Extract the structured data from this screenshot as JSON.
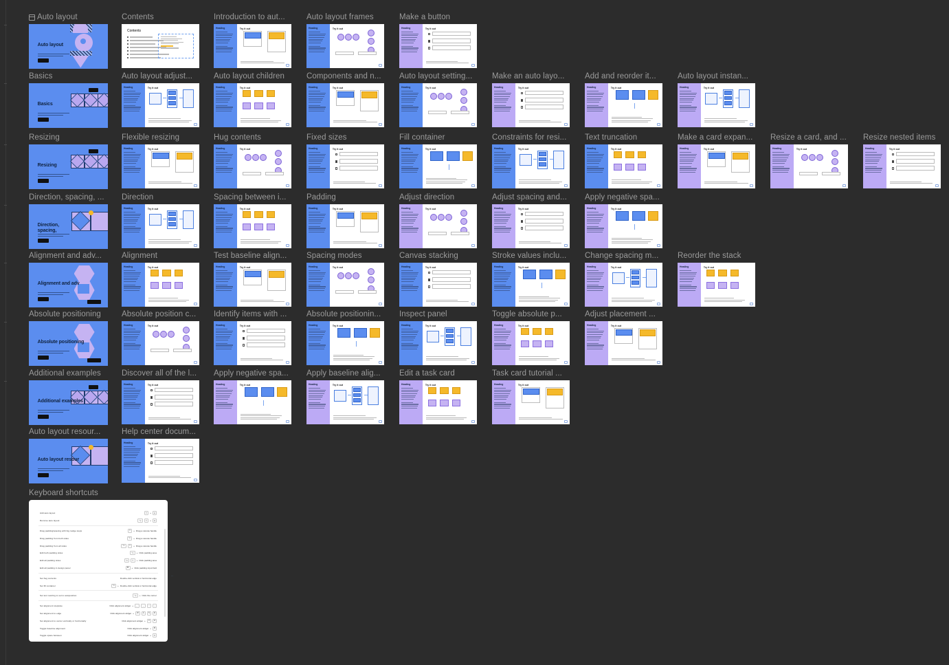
{
  "app": {
    "background_color": "#2c2c2c",
    "label_color": "#9b9b9b",
    "accent_blue": "#5b8def",
    "accent_purple": "#bcaaf5",
    "accent_yellow": "#f5b92a",
    "lavender_shape": "#c5b3f2"
  },
  "section": {
    "icon": "section-icon",
    "title": "Auto layout"
  },
  "frames": [
    {
      "title": "Auto layout",
      "style": "cover-blue",
      "row": 0,
      "col": 0,
      "wide": true
    },
    {
      "title": "Contents",
      "style": "doc-plain",
      "row": 0,
      "col": 1
    },
    {
      "title": "Introduction to aut...",
      "style": "doc-blue",
      "row": 0,
      "col": 2
    },
    {
      "title": "Auto layout frames",
      "style": "doc-blue",
      "row": 0,
      "col": 3
    },
    {
      "title": "Make a button",
      "style": "doc-purple",
      "row": 0,
      "col": 4
    },
    {
      "title": "Basics",
      "style": "cover-blue",
      "row": 1,
      "col": 0,
      "wide": true
    },
    {
      "title": "Auto layout adjust...",
      "style": "doc-blue",
      "row": 1,
      "col": 1
    },
    {
      "title": "Auto layout children",
      "style": "doc-blue",
      "row": 1,
      "col": 2
    },
    {
      "title": "Components and n...",
      "style": "doc-blue",
      "row": 1,
      "col": 3
    },
    {
      "title": "Auto layout setting...",
      "style": "doc-blue",
      "row": 1,
      "col": 4
    },
    {
      "title": "Make an auto layo...",
      "style": "doc-purple",
      "row": 1,
      "col": 5
    },
    {
      "title": "Add and reorder it...",
      "style": "doc-purple",
      "row": 1,
      "col": 6
    },
    {
      "title": "Auto layout instan...",
      "style": "doc-purple",
      "row": 1,
      "col": 7
    },
    {
      "title": "Resizing",
      "style": "cover-blue",
      "row": 2,
      "col": 0,
      "wide": true
    },
    {
      "title": "Flexible resizing",
      "style": "doc-blue",
      "row": 2,
      "col": 1
    },
    {
      "title": "Hug contents",
      "style": "doc-blue",
      "row": 2,
      "col": 2
    },
    {
      "title": "Fixed sizes",
      "style": "doc-blue",
      "row": 2,
      "col": 3
    },
    {
      "title": "Fill container",
      "style": "doc-blue",
      "row": 2,
      "col": 4
    },
    {
      "title": "Constraints for resi...",
      "style": "doc-blue",
      "row": 2,
      "col": 5
    },
    {
      "title": "Text truncation",
      "style": "doc-blue",
      "row": 2,
      "col": 6
    },
    {
      "title": "Make a card expan...",
      "style": "doc-purple",
      "row": 2,
      "col": 7
    },
    {
      "title": "Resize a card, and ...",
      "style": "doc-purple",
      "row": 2,
      "col": 8
    },
    {
      "title": "Resize nested items",
      "style": "doc-purple",
      "row": 2,
      "col": 9
    },
    {
      "title": "Direction, spacing, ...",
      "style": "cover-blue",
      "row": 3,
      "col": 0,
      "wide": true
    },
    {
      "title": "Direction",
      "style": "doc-blue",
      "row": 3,
      "col": 1
    },
    {
      "title": "Spacing between i...",
      "style": "doc-blue",
      "row": 3,
      "col": 2
    },
    {
      "title": "Padding",
      "style": "doc-blue",
      "row": 3,
      "col": 3
    },
    {
      "title": "Adjust direction",
      "style": "doc-purple",
      "row": 3,
      "col": 4
    },
    {
      "title": "Adjust spacing and...",
      "style": "doc-purple",
      "row": 3,
      "col": 5
    },
    {
      "title": "Apply negative spa...",
      "style": "doc-purple",
      "row": 3,
      "col": 6
    },
    {
      "title": "Alignment and adv...",
      "style": "cover-blue",
      "row": 4,
      "col": 0,
      "wide": true
    },
    {
      "title": "Alignment",
      "style": "doc-blue",
      "row": 4,
      "col": 1
    },
    {
      "title": "Test baseline align...",
      "style": "doc-blue",
      "row": 4,
      "col": 2
    },
    {
      "title": "Spacing modes",
      "style": "doc-blue",
      "row": 4,
      "col": 3
    },
    {
      "title": "Canvas stacking",
      "style": "doc-blue",
      "row": 4,
      "col": 4
    },
    {
      "title": "Stroke values inclu...",
      "style": "doc-blue",
      "row": 4,
      "col": 5
    },
    {
      "title": "Change spacing m...",
      "style": "doc-purple",
      "row": 4,
      "col": 6
    },
    {
      "title": "Reorder the stack",
      "style": "doc-purple",
      "row": 4,
      "col": 7
    },
    {
      "title": "Absolute positioning",
      "style": "cover-blue",
      "row": 5,
      "col": 0,
      "wide": true
    },
    {
      "title": "Absolute position c...",
      "style": "doc-blue",
      "row": 5,
      "col": 1
    },
    {
      "title": "Identify items with ...",
      "style": "doc-blue",
      "row": 5,
      "col": 2
    },
    {
      "title": "Absolute positionin...",
      "style": "doc-blue",
      "row": 5,
      "col": 3
    },
    {
      "title": "Inspect panel",
      "style": "doc-blue",
      "row": 5,
      "col": 4
    },
    {
      "title": "Toggle absolute p...",
      "style": "doc-purple",
      "row": 5,
      "col": 5
    },
    {
      "title": "Adjust placement ...",
      "style": "doc-purple",
      "row": 5,
      "col": 6
    },
    {
      "title": "Additional examples",
      "style": "cover-blue",
      "row": 6,
      "col": 0,
      "wide": true
    },
    {
      "title": "Discover all of the l...",
      "style": "doc-blue",
      "row": 6,
      "col": 1
    },
    {
      "title": "Apply negative spa...",
      "style": "doc-purple",
      "row": 6,
      "col": 2
    },
    {
      "title": "Apply baseline alig...",
      "style": "doc-purple",
      "row": 6,
      "col": 3
    },
    {
      "title": "Edit a task card",
      "style": "doc-purple",
      "row": 6,
      "col": 4
    },
    {
      "title": "Task card tutorial ...",
      "style": "doc-purple",
      "row": 6,
      "col": 5
    },
    {
      "title": "Auto layout resour...",
      "style": "cover-blue",
      "row": 7,
      "col": 0,
      "wide": true
    },
    {
      "title": "Help center docum...",
      "style": "doc-blue",
      "row": 7,
      "col": 1
    }
  ],
  "keyboard_shortcuts": {
    "title": "Keyboard shortcuts",
    "groups": [
      {
        "rows": [
          {
            "label": "Add auto layout",
            "keys": [
              "⇧",
              "+",
              "A"
            ]
          },
          {
            "label": "Remove auto layout",
            "keys": [
              "⌥",
              "⇧",
              "+",
              "A"
            ]
          }
        ]
      },
      {
        "rows": [
          {
            "label": "Drag padding/spacing with big nudge steps",
            "keys": [
              "⇧",
              "+",
              "Drag a canvas handle"
            ]
          },
          {
            "label": "Drag padding from both sides",
            "keys": [
              "⌥",
              "+",
              "Drag a canvas handle"
            ]
          },
          {
            "label": "Drag padding from all sides",
            "keys": [
              "⌥",
              "⇧",
              "+",
              "Drag a canvas handle"
            ]
          },
          {
            "label": "Edit both padding sides",
            "keys": [
              "⌥",
              "+",
              "Click padding area"
            ]
          },
          {
            "label": "Edit all padding sides",
            "keys": [
              "⌥",
              "⇧",
              "+",
              "Click padding area"
            ]
          },
          {
            "label": "Edit all padding in design panel",
            "keys": [
              "⌘",
              "+",
              "Click padding input field"
            ]
          }
        ]
      },
      {
        "rows": [
          {
            "label": "Set hug contents",
            "keys": [
              "Double-click vertical or horizontal edge"
            ]
          },
          {
            "label": "Set fill container",
            "keys": [
              "⌥",
              "+",
              "Double-click vertical or horizontal edge"
            ]
          }
        ]
      },
      {
        "rows": [
          {
            "label": "Set text resizing to set to autoposition",
            "keys": [
              "⌥",
              "+",
              "Click the corner"
            ]
          }
        ]
      },
      {
        "rows": [
          {
            "label": "Set alignment stepwise",
            "keys": [
              "Click alignment widget",
              "+",
              "←",
              "→",
              "↑",
              "↓"
            ]
          },
          {
            "label": "Set alignment to edge",
            "keys": [
              "Click alignment widget",
              "+",
              "W",
              "A",
              "S",
              "D"
            ]
          },
          {
            "label": "Set alignment to center vertically or horizontally",
            "keys": [
              "Click alignment widget",
              "+",
              "V",
              "H"
            ]
          },
          {
            "label": "Toggle baseline alignment",
            "keys": [
              "Click alignment widget",
              "+",
              "B"
            ]
          },
          {
            "label": "Toggle space between",
            "keys": [
              "Click alignment widget",
              "+",
              "X"
            ]
          }
        ]
      }
    ]
  }
}
